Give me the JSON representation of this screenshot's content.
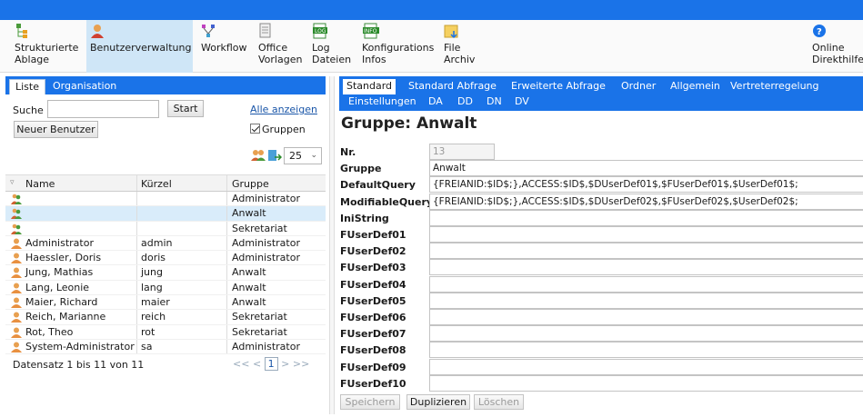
{
  "toolbar": {
    "items": [
      {
        "label": "Strukturierte\nAblage",
        "icon": "structure-icon"
      },
      {
        "label": "Benutzerverwaltung",
        "icon": "user-admin-icon"
      },
      {
        "label": "Workflow",
        "icon": "workflow-icon"
      },
      {
        "label": "Office\nVorlagen",
        "icon": "office-template-icon"
      },
      {
        "label": "Log\nDateien",
        "icon": "log-icon"
      },
      {
        "label": "Konfigurations\nInfos",
        "icon": "info-icon"
      },
      {
        "label": "File\nArchiv",
        "icon": "file-archive-icon"
      },
      {
        "label": "Online\nDirekthilfe",
        "icon": "help-icon"
      }
    ],
    "log_badge": "LOG",
    "info_badge": "INFO"
  },
  "left": {
    "tabs": [
      "Liste",
      "Organisation"
    ],
    "search_label": "Suche",
    "search_value": "",
    "start_button": "Start",
    "alle_anzeigen": "Alle anzeigen",
    "new_user_button": "Neuer Benutzer",
    "gruppen_label": "Gruppen",
    "page_size": "25",
    "columns": [
      "Name",
      "Kürzel",
      "Gruppe"
    ],
    "rows": [
      {
        "name": "",
        "kuerzel": "",
        "gruppe": "Administrator",
        "icon": "group-icon"
      },
      {
        "name": "",
        "kuerzel": "",
        "gruppe": "Anwalt",
        "icon": "group-icon"
      },
      {
        "name": "",
        "kuerzel": "",
        "gruppe": "Sekretariat",
        "icon": "group-icon"
      },
      {
        "name": "Administrator",
        "kuerzel": "admin",
        "gruppe": "Administrator",
        "icon": "user-icon"
      },
      {
        "name": "Haessler, Doris",
        "kuerzel": "doris",
        "gruppe": "Administrator",
        "icon": "user-icon"
      },
      {
        "name": "Jung, Mathias",
        "kuerzel": "jung",
        "gruppe": "Anwalt",
        "icon": "user-icon"
      },
      {
        "name": "Lang, Leonie",
        "kuerzel": "lang",
        "gruppe": "Anwalt",
        "icon": "user-icon"
      },
      {
        "name": "Maier, Richard",
        "kuerzel": "maier",
        "gruppe": "Anwalt",
        "icon": "user-icon"
      },
      {
        "name": "Reich, Marianne",
        "kuerzel": "reich",
        "gruppe": "Sekretariat",
        "icon": "user-icon"
      },
      {
        "name": "Rot, Theo",
        "kuerzel": "rot",
        "gruppe": "Sekretariat",
        "icon": "user-icon"
      },
      {
        "name": "System-Administrator",
        "kuerzel": "sa",
        "gruppe": "Administrator",
        "icon": "user-icon"
      }
    ],
    "footer": "Datensatz 1 bis 11 von 11",
    "pager": {
      "first": "<<",
      "prev": "<",
      "current": "1",
      "next": ">",
      "last": ">>"
    }
  },
  "right": {
    "tabs_row1": [
      "Standard",
      "Standard Abfrage",
      "Erweiterte Abfrage",
      "Ordner",
      "Allgemein",
      "Vertreterregelung"
    ],
    "tabs_row2": [
      "Einstellungen",
      "DA",
      "DD",
      "DN",
      "DV"
    ],
    "title": "Gruppe: Anwalt",
    "fields": [
      {
        "label": "Nr.",
        "value": "13"
      },
      {
        "label": "Gruppe",
        "value": "Anwalt"
      },
      {
        "label": "DefaultQuery",
        "value": "{FREIANID:$ID$;},ACCESS:$ID$,$DUserDef01$,$FUserDef01$,$UserDef01$;"
      },
      {
        "label": "ModifiableQuery",
        "value": "{FREIANID:$ID$;},ACCESS:$ID$,$DUserDef02$,$FUserDef02$,$UserDef02$;"
      },
      {
        "label": "IniString",
        "value": ""
      },
      {
        "label": "FUserDef01",
        "value": ""
      },
      {
        "label": "FUserDef02",
        "value": ""
      },
      {
        "label": "FUserDef03",
        "value": ""
      },
      {
        "label": "FUserDef04",
        "value": ""
      },
      {
        "label": "FUserDef05",
        "value": ""
      },
      {
        "label": "FUserDef06",
        "value": ""
      },
      {
        "label": "FUserDef07",
        "value": ""
      },
      {
        "label": "FUserDef08",
        "value": ""
      },
      {
        "label": "FUserDef09",
        "value": ""
      },
      {
        "label": "FUserDef10",
        "value": ""
      }
    ],
    "buttons": [
      "Speichern",
      "Duplizieren",
      "Löschen"
    ]
  },
  "colors": {
    "accent": "#1a73e8",
    "selection": "#d9ecfa",
    "link": "#1a56a8"
  }
}
